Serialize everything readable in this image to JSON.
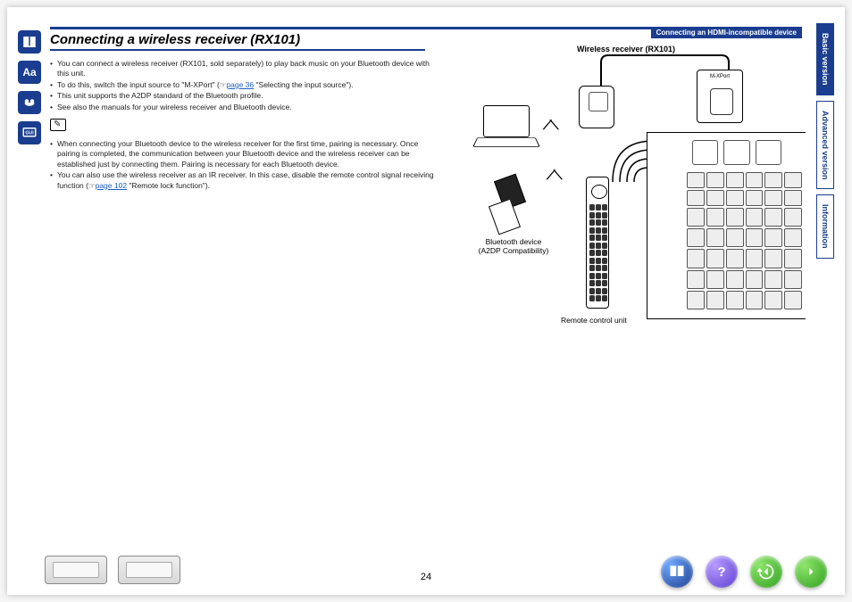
{
  "header": {
    "section_tag": "Connecting an HDMI-incompatible device",
    "title": "Connecting a wireless receiver (RX101)"
  },
  "body": {
    "bullets_main": [
      "You can connect a wireless receiver (RX101, sold separately) to play back music on your Bluetooth device with this unit.",
      "To do this, switch the input source to \"M-XPort\" (☞",
      "This unit supports the A2DP standard of the Bluetooth profile.",
      "See also the manuals for your wireless receiver and Bluetooth device."
    ],
    "link1_text": "page 36",
    "link1_after": " \"Selecting the input source\").",
    "bullets_note": [
      "When connecting your Bluetooth device to the wireless receiver for the first time, pairing is necessary. Once pairing is completed, the communication between your Bluetooth device and the wireless receiver can be established just by connecting them. Pairing is necessary for each Bluetooth device.",
      "You can also use the wireless receiver as an IR receiver. In this case, disable the remote control signal receiving function (☞"
    ],
    "link2_text": "page 102",
    "link2_after": " \"Remote lock function\")."
  },
  "diagram": {
    "wireless_label": "Wireless receiver (RX101)",
    "bt_caption_line1": "Bluetooth device",
    "bt_caption_line2": "(A2DP Compatibility)",
    "remote_caption": "Remote control unit",
    "mxport_label": "M-XPort"
  },
  "tabs": {
    "basic": "Basic version",
    "advanced": "Advanced version",
    "info": "Information"
  },
  "footer": {
    "page_number": "24"
  }
}
